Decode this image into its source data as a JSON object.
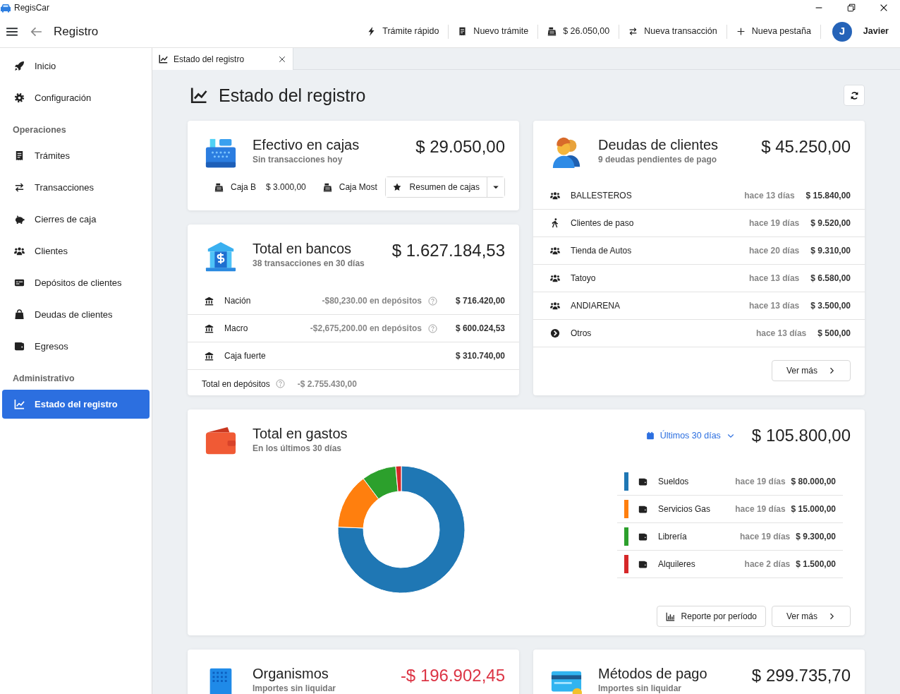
{
  "app": {
    "title": "RegisCar"
  },
  "topbar": {
    "title": "Registro",
    "actions": [
      {
        "label": "Trámite rápido"
      },
      {
        "label": "Nuevo trámite"
      },
      {
        "label": "$ 26.050,00"
      },
      {
        "label": "Nueva transacción"
      },
      {
        "label": "Nueva pestaña"
      }
    ],
    "user": {
      "initial": "J",
      "name": "Javier"
    }
  },
  "sidebar": {
    "items": [
      {
        "kind": "item",
        "label": "Inicio",
        "selected": false
      },
      {
        "kind": "item",
        "label": "Configuración",
        "selected": false
      },
      {
        "kind": "heading",
        "label": "Operaciones"
      },
      {
        "kind": "item",
        "label": "Trámites",
        "selected": false
      },
      {
        "kind": "item",
        "label": "Transacciones",
        "selected": false
      },
      {
        "kind": "item",
        "label": "Cierres de caja",
        "selected": false
      },
      {
        "kind": "item",
        "label": "Clientes",
        "selected": false
      },
      {
        "kind": "item",
        "label": "Depósitos de clientes",
        "selected": false
      },
      {
        "kind": "item",
        "label": "Deudas de clientes",
        "selected": false
      },
      {
        "kind": "item",
        "label": "Egresos",
        "selected": false
      },
      {
        "kind": "heading",
        "label": "Administrativo"
      },
      {
        "kind": "item",
        "label": "Estado del registro",
        "selected": true
      }
    ]
  },
  "tabs": [
    {
      "label": "Estado del registro",
      "selected": true
    }
  ],
  "page": {
    "title": "Estado del registro"
  },
  "cash": {
    "title": "Efectivo en cajas",
    "subtitle": "Sin transacciones hoy",
    "total": "$ 29.050,00",
    "registers": [
      {
        "name": "Caja B",
        "amount": "$ 3.000,00"
      },
      {
        "name": "Caja Most"
      }
    ],
    "summary_button": "Resumen de cajas"
  },
  "banks": {
    "title": "Total en bancos",
    "subtitle": "38 transacciones en 30 días",
    "total": "$ 1.627.184,53",
    "accounts": [
      {
        "name": "Nación",
        "deposits": "-$80,230.00 en depósitos",
        "amount": "$ 716.420,00"
      },
      {
        "name": "Macro",
        "deposits": "-$2,675,200.00 en depósitos",
        "amount": "$ 600.024,53"
      },
      {
        "name": "Caja fuerte",
        "amount": "$ 310.740,00"
      }
    ],
    "footer": {
      "label": "Total en depósitos",
      "amount": "-$ 2.755.430,00"
    }
  },
  "debts": {
    "title": "Deudas de clientes",
    "subtitle": "9 deudas pendientes de pago",
    "total": "$ 45.250,00",
    "rows": [
      {
        "kind": "client",
        "name": "BALLESTEROS",
        "ago": "hace 13 días",
        "amount": "$ 15.840,00"
      },
      {
        "kind": "walk_in",
        "name": "Clientes de paso",
        "ago": "hace 19 días",
        "amount": "$ 9.520,00"
      },
      {
        "kind": "client",
        "name": "Tienda de Autos",
        "ago": "hace 20 días",
        "amount": "$ 9.310,00"
      },
      {
        "kind": "client",
        "name": "Tatoyo",
        "ago": "hace 13 días",
        "amount": "$ 6.580,00"
      },
      {
        "kind": "client",
        "name": "ANDIARENA",
        "ago": "hace 13 días",
        "amount": "$ 3.500,00"
      },
      {
        "kind": "other",
        "name": "Otros",
        "ago": "hace 13 días",
        "amount": "$ 500,00"
      }
    ],
    "more_button": "Ver más"
  },
  "expenses": {
    "title": "Total en gastos",
    "subtitle": "En los últimos 30 días",
    "period": "Últimos 30 días",
    "total": "$ 105.800,00",
    "items": [
      {
        "name": "Sueldos",
        "ago": "hace 19 días",
        "amount": "$ 80.000,00",
        "color": "#1f77b4"
      },
      {
        "name": "Servicios Gas",
        "ago": "hace 19 días",
        "amount": "$ 15.000,00",
        "color": "#ff7f0e"
      },
      {
        "name": "Librería",
        "ago": "hace 19 días",
        "amount": "$ 9.300,00",
        "color": "#2ca02c"
      },
      {
        "name": "Alquileres",
        "ago": "hace 2 días",
        "amount": "$ 1.500,00",
        "color": "#d62728"
      }
    ],
    "chart_data": {
      "type": "donut",
      "values": [
        75.61,
        14.18,
        8.79,
        1.42
      ]
    },
    "report_button": "Reporte por período",
    "more_button": "Ver más"
  },
  "bottom_cards": [
    {
      "kind": "agencies",
      "title": "Organismos",
      "subtitle": "Importes sin liquidar",
      "total": "-$ 196.902,45",
      "negative": true
    },
    {
      "kind": "payment_methods",
      "title": "Métodos de pago",
      "subtitle": "Importes sin liquidar",
      "total": "$ 299.735,70",
      "negative": false
    }
  ]
}
